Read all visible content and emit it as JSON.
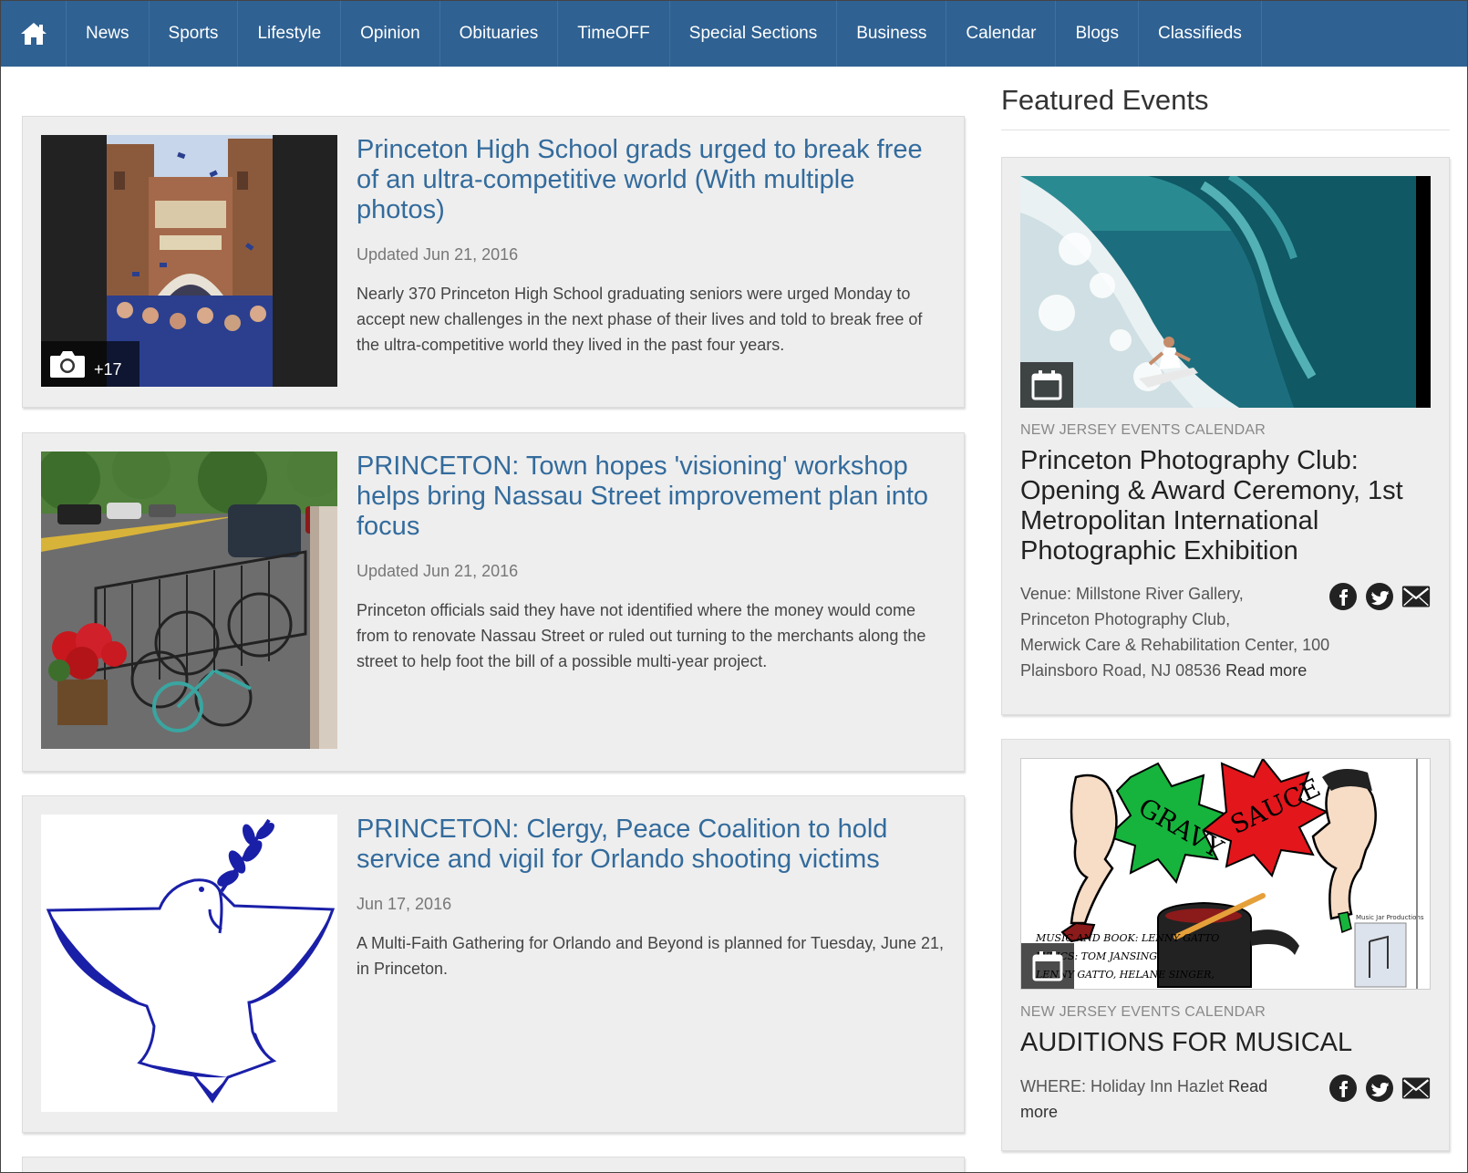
{
  "nav": {
    "items": [
      "News",
      "Sports",
      "Lifestyle",
      "Opinion",
      "Obituaries",
      "TimeOFF",
      "Special Sections",
      "Business",
      "Calendar",
      "Blogs",
      "Classifieds"
    ]
  },
  "articles": [
    {
      "title": "Princeton High School grads urged to break free of an ultra-competitive world (With multiple photos)",
      "date": "Updated Jun 21, 2016",
      "summary": "Nearly 370 Princeton High School graduating seniors were urged Monday to accept new challenges in the next phase of their lives and told to break free of the ultra-competitive world they lived in the past four years.",
      "photo_count": "+17"
    },
    {
      "title": "PRINCETON: Town hopes 'visioning' workshop helps bring Nassau Street improvement plan into focus",
      "date": "Updated Jun 21, 2016",
      "summary": "Princeton officials said they have not identified where the money would come from to renovate Nassau Street or ruled out turning to the merchants along the street to help foot the bill of a possible multi-year project."
    },
    {
      "title": "PRINCETON: Clergy, Peace Coalition to hold service and vigil for Orlando shooting victims",
      "date": "Jun 17, 2016",
      "summary": "A Multi-Faith Gathering for Orlando and Beyond is planned for Tuesday, June 21, in Princeton."
    }
  ],
  "sidebar": {
    "title": "Featured Events",
    "events": [
      {
        "category": "NEW JERSEY EVENTS CALENDAR",
        "title": "Princeton Photography Club: Opening & Award Ceremony, 1st Metropolitan International Photographic Exhibition",
        "desc_line1": "Venue: Millstone River Gallery,",
        "desc_line2": "Princeton Photography Club,",
        "desc_line3": "Merwick Care & Rehabilitation Center, 100",
        "desc_line4": "Plainsboro Road, NJ 08536",
        "read_more": "Read more"
      },
      {
        "category": "NEW JERSEY EVENTS CALENDAR",
        "title": "AUDITIONS FOR MUSICAL",
        "desc_line1": "WHERE: Holiday Inn Hazlet",
        "read_more_1": "Read",
        "read_more_2": "more",
        "poster": {
          "word1": "GRAVY",
          "word2": "SAUCE",
          "credit1": "MUSIC AND BOOK: LENNY GATTO",
          "credit2": "LYRICS: TOM JANSING,",
          "credit3": "LENNY GATTO, HELANE SINGER,",
          "producer": "Music Jar Productions"
        }
      }
    ]
  }
}
